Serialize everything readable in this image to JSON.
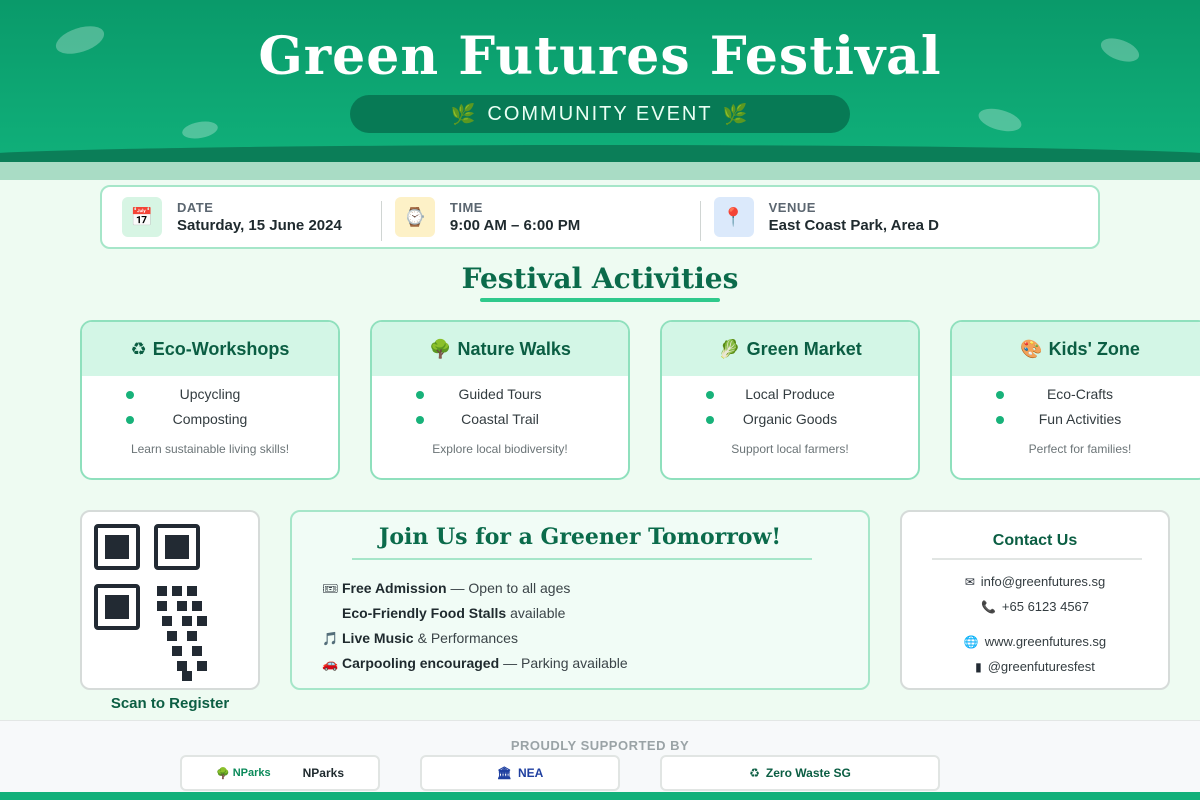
{
  "header": {
    "title": "Green Futures Festival",
    "subtitle": "COMMUNITY EVENT",
    "subtitle_icon": "🌿",
    "bg_color": "#10b07a"
  },
  "info": [
    {
      "label": "DATE",
      "value": "Saturday, 15 June 2024",
      "icon": "calendar-icon",
      "glyph": "📅"
    },
    {
      "label": "TIME",
      "value": "9:00 AM – 6:00 PM",
      "icon": "clock-icon",
      "glyph": "⌚"
    },
    {
      "label": "VENUE",
      "value": "East Coast Park, Area D",
      "icon": "pin-icon",
      "glyph": "📍"
    }
  ],
  "activities": {
    "title": "Festival Activities",
    "cards": [
      {
        "name": "Eco-Workshops",
        "glyph": "♻",
        "items": [
          "Upcycling",
          "Composting"
        ],
        "note": "Learn sustainable living skills!"
      },
      {
        "name": "Nature Walks",
        "glyph": "🌳",
        "items": [
          "Guided Tours",
          "Coastal Trail"
        ],
        "note": "Explore local biodiversity!"
      },
      {
        "name": "Green Market",
        "glyph": "🥬",
        "items": [
          "Local Produce",
          "Organic Goods"
        ],
        "note": "Support local farmers!"
      },
      {
        "name": "Kids' Zone",
        "glyph": "🎨",
        "items": [
          "Eco-Crafts",
          "Fun Activities"
        ],
        "note": "Perfect for families!"
      }
    ]
  },
  "qr": {
    "caption": "Scan to Register"
  },
  "join": {
    "title": "Join Us for a Greener Tomorrow!",
    "items": [
      {
        "glyph": "🎟",
        "bold": "Free Admission",
        "rest": "— Open to all ages"
      },
      {
        "glyph": "",
        "bold": "Eco-Friendly Food Stalls",
        "rest": "available"
      },
      {
        "glyph": "🎵",
        "bold": "Live Music",
        "rest": "& Performances"
      },
      {
        "glyph": "🚗",
        "bold": "Carpooling encouraged",
        "rest": "— Parking available"
      }
    ]
  },
  "contact": {
    "title": "Contact Us",
    "email": "info@greenfutures.sg",
    "phone": "+65 6123 4567",
    "website": "www.greenfutures.sg",
    "social": "@greenfuturesfest"
  },
  "footer": {
    "label": "PROUDLY SUPPORTED BY",
    "sponsors": [
      {
        "name": "NParks",
        "logo_text": "NParks",
        "color": "#0b8a5a"
      },
      {
        "name": "NEA",
        "color": "#1f3fa0"
      },
      {
        "name": "Zero Waste SG",
        "color": "#0b5e43"
      }
    ]
  }
}
